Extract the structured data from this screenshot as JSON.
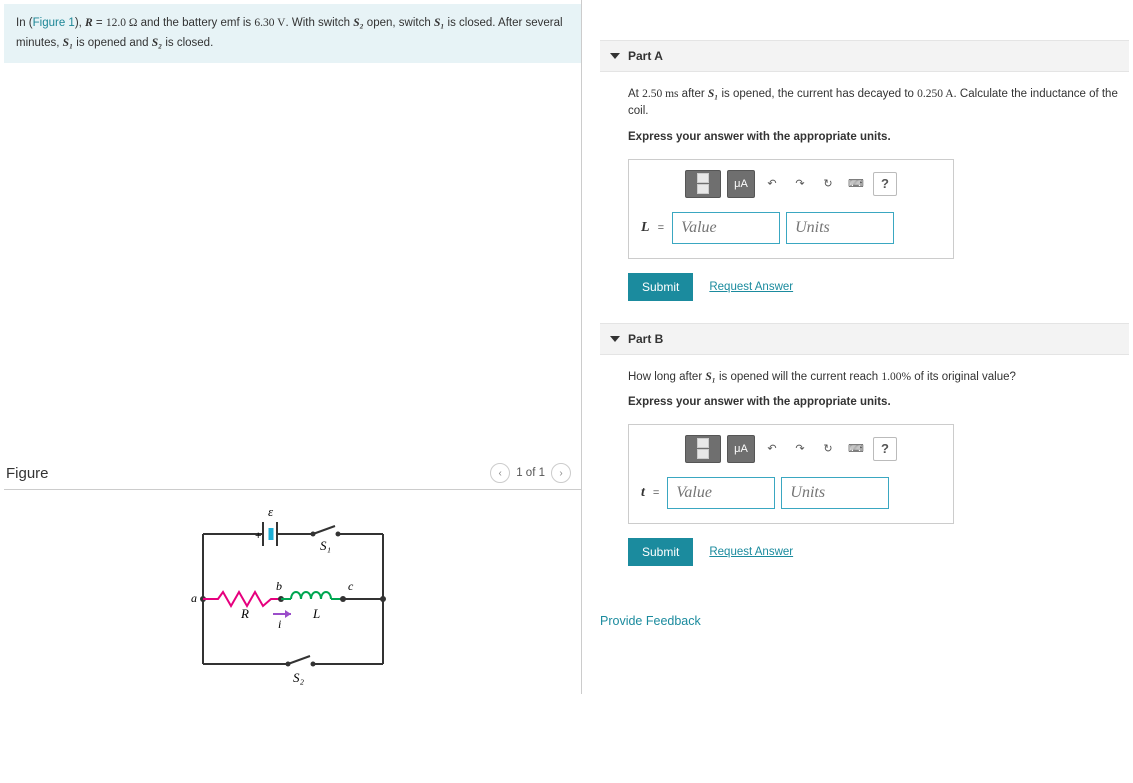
{
  "problem": {
    "figure_link": "Figure 1",
    "text_prefix": "In (",
    "text_mid1": "), ",
    "R_var": "R",
    "R_val": "12.0 Ω",
    "emf_text": " and the battery emf is ",
    "emf_val": "6.30 V",
    "after_emf": ". With switch ",
    "S2": "S₂",
    "open_text": " open, switch ",
    "S1": "S₁",
    "closed_text": " is closed. After several minutes, ",
    "S1b": "S₁",
    "opened_text": " is opened and ",
    "S2b": "S₂",
    "final": " is closed."
  },
  "figure": {
    "heading": "Figure",
    "pager": "1 of 1",
    "labels": {
      "eps": "ε",
      "S1": "S₁",
      "S2": "S₂",
      "a": "a",
      "b": "b",
      "c": "c",
      "R": "R",
      "L": "L",
      "i": "i",
      "plus": "+"
    }
  },
  "partA": {
    "title": "Part A",
    "prompt_pre": "At ",
    "t_val": "2.50 ms",
    "prompt_mid": " after ",
    "S1": "S₁",
    "prompt_after": " is opened, the current has decayed to ",
    "I_val": "0.250 A",
    "prompt_end": ". Calculate the inductance of the coil.",
    "instruct": "Express your answer with the appropriate units.",
    "var_label": "L",
    "value_ph": "Value",
    "units_ph": "Units"
  },
  "partB": {
    "title": "Part B",
    "prompt_pre": "How long after ",
    "S1": "S₁",
    "prompt_mid": " is opened will the current reach ",
    "pct": "1.00%",
    "prompt_end": " of its original value?",
    "instruct": "Express your answer with the appropriate units.",
    "var_label": "t",
    "value_ph": "Value",
    "units_ph": "Units"
  },
  "toolbar": {
    "mu_a": "μA",
    "undo": "↶",
    "redo": "↷",
    "reset": "↻",
    "keyboard": "⌨",
    "help": "?"
  },
  "buttons": {
    "submit": "Submit",
    "request": "Request Answer",
    "feedback": "Provide Feedback"
  }
}
